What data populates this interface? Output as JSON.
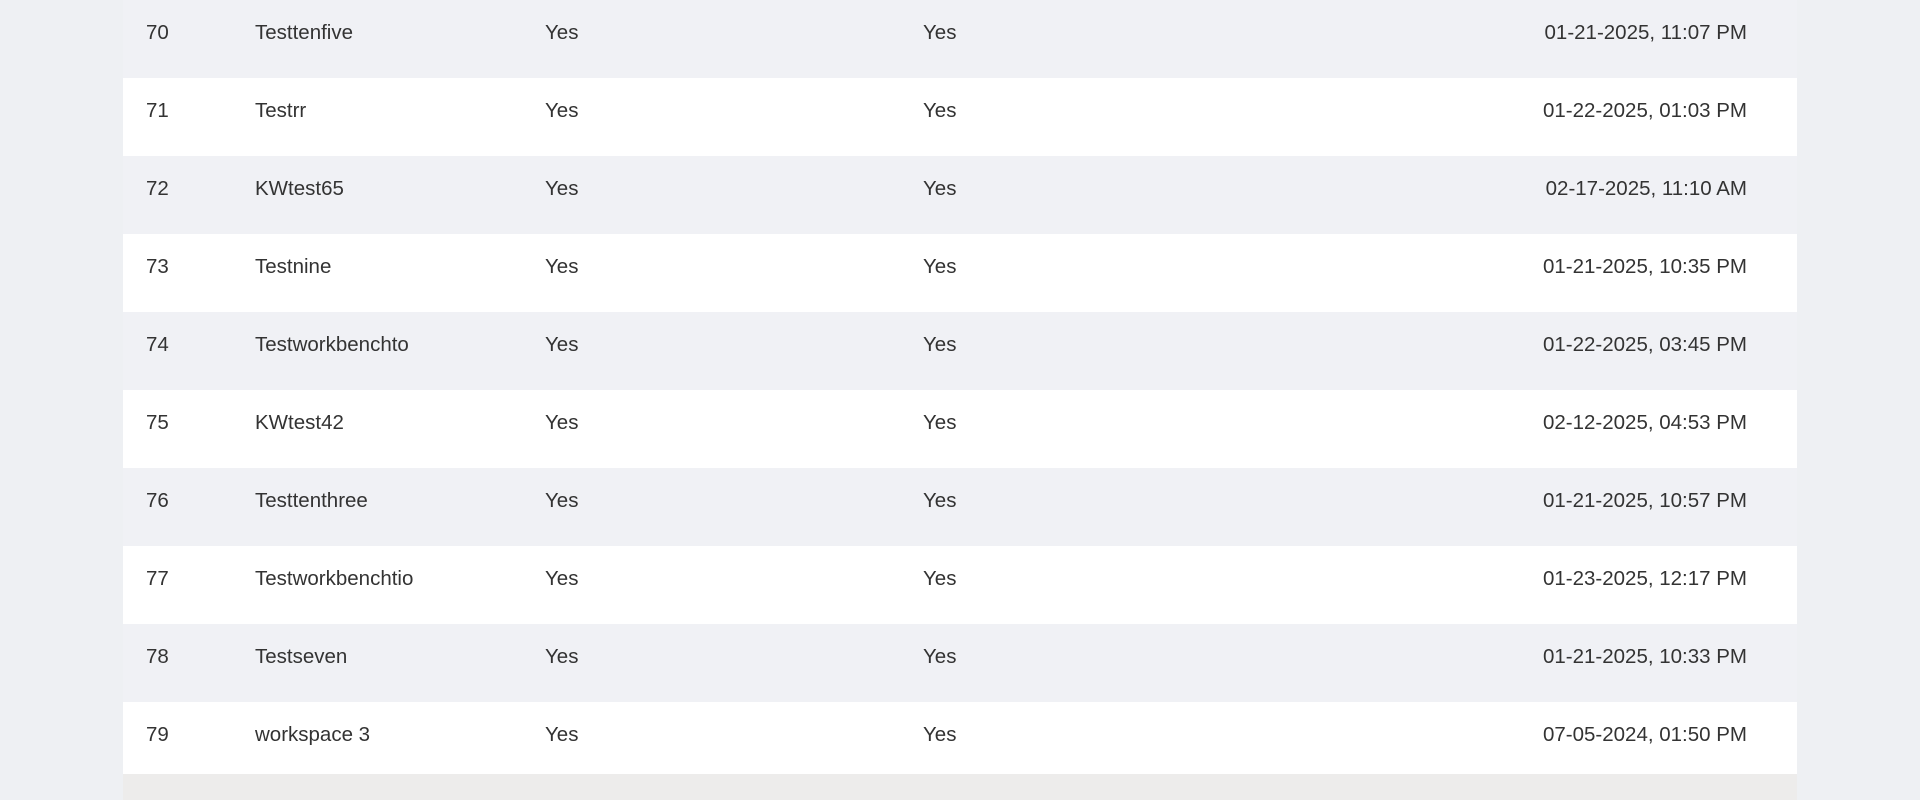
{
  "table": {
    "rows": [
      {
        "id": "70",
        "name": "Testtenfive",
        "col_a": "Yes",
        "col_b": "Yes",
        "date": "01-21-2025, 11:07 PM"
      },
      {
        "id": "71",
        "name": "Testrr",
        "col_a": "Yes",
        "col_b": "Yes",
        "date": "01-22-2025, 01:03 PM"
      },
      {
        "id": "72",
        "name": "KWtest65",
        "col_a": "Yes",
        "col_b": "Yes",
        "date": "02-17-2025, 11:10 AM"
      },
      {
        "id": "73",
        "name": "Testnine",
        "col_a": "Yes",
        "col_b": "Yes",
        "date": "01-21-2025, 10:35 PM"
      },
      {
        "id": "74",
        "name": "Testworkbenchto",
        "col_a": "Yes",
        "col_b": "Yes",
        "date": "01-22-2025, 03:45 PM"
      },
      {
        "id": "75",
        "name": "KWtest42",
        "col_a": "Yes",
        "col_b": "Yes",
        "date": "02-12-2025, 04:53 PM"
      },
      {
        "id": "76",
        "name": "Testtenthree",
        "col_a": "Yes",
        "col_b": "Yes",
        "date": "01-21-2025, 10:57 PM"
      },
      {
        "id": "77",
        "name": "Testworkbenchtio",
        "col_a": "Yes",
        "col_b": "Yes",
        "date": "01-23-2025, 12:17 PM"
      },
      {
        "id": "78",
        "name": "Testseven",
        "col_a": "Yes",
        "col_b": "Yes",
        "date": "01-21-2025, 10:33 PM"
      },
      {
        "id": "79",
        "name": "workspace 3",
        "col_a": "Yes",
        "col_b": "Yes",
        "date": "07-05-2024, 01:50 PM"
      }
    ]
  }
}
